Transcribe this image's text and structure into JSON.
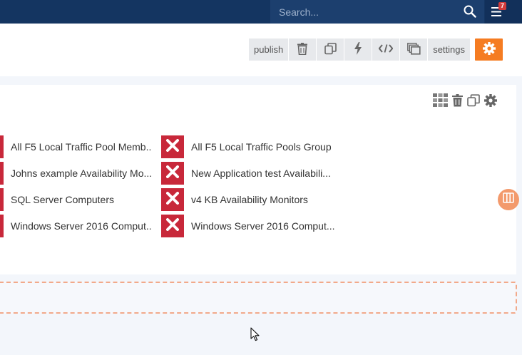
{
  "search": {
    "placeholder": "Search..."
  },
  "notifications": {
    "count": "7"
  },
  "toolbar": {
    "publish_label": "publish",
    "settings_label": "settings",
    "icons": [
      "trash-icon",
      "copy-icon",
      "lightning-icon",
      "code-icon",
      "layers-icon",
      "gear-icon"
    ]
  },
  "panel": {
    "toolbar_icons": [
      "grid-icon",
      "trash-icon",
      "copy-icon",
      "gear-icon"
    ]
  },
  "left_column": [
    {
      "label": "All F5 Local Traffic Pool Memb..."
    },
    {
      "label": "Johns example Availability Mo..."
    },
    {
      "label": "SQL Server Computers"
    },
    {
      "label": "Windows Server 2016 Comput..."
    }
  ],
  "right_column": [
    {
      "label": "All F5 Local Traffic Pools Group"
    },
    {
      "label": "New Application test Availabili..."
    },
    {
      "label": "v4 KB Availability Monitors"
    },
    {
      "label": "Windows Server 2016 Comput..."
    }
  ],
  "colors": {
    "nav": "#143561",
    "accent": "#f57c22",
    "remove": "#c8283a"
  }
}
